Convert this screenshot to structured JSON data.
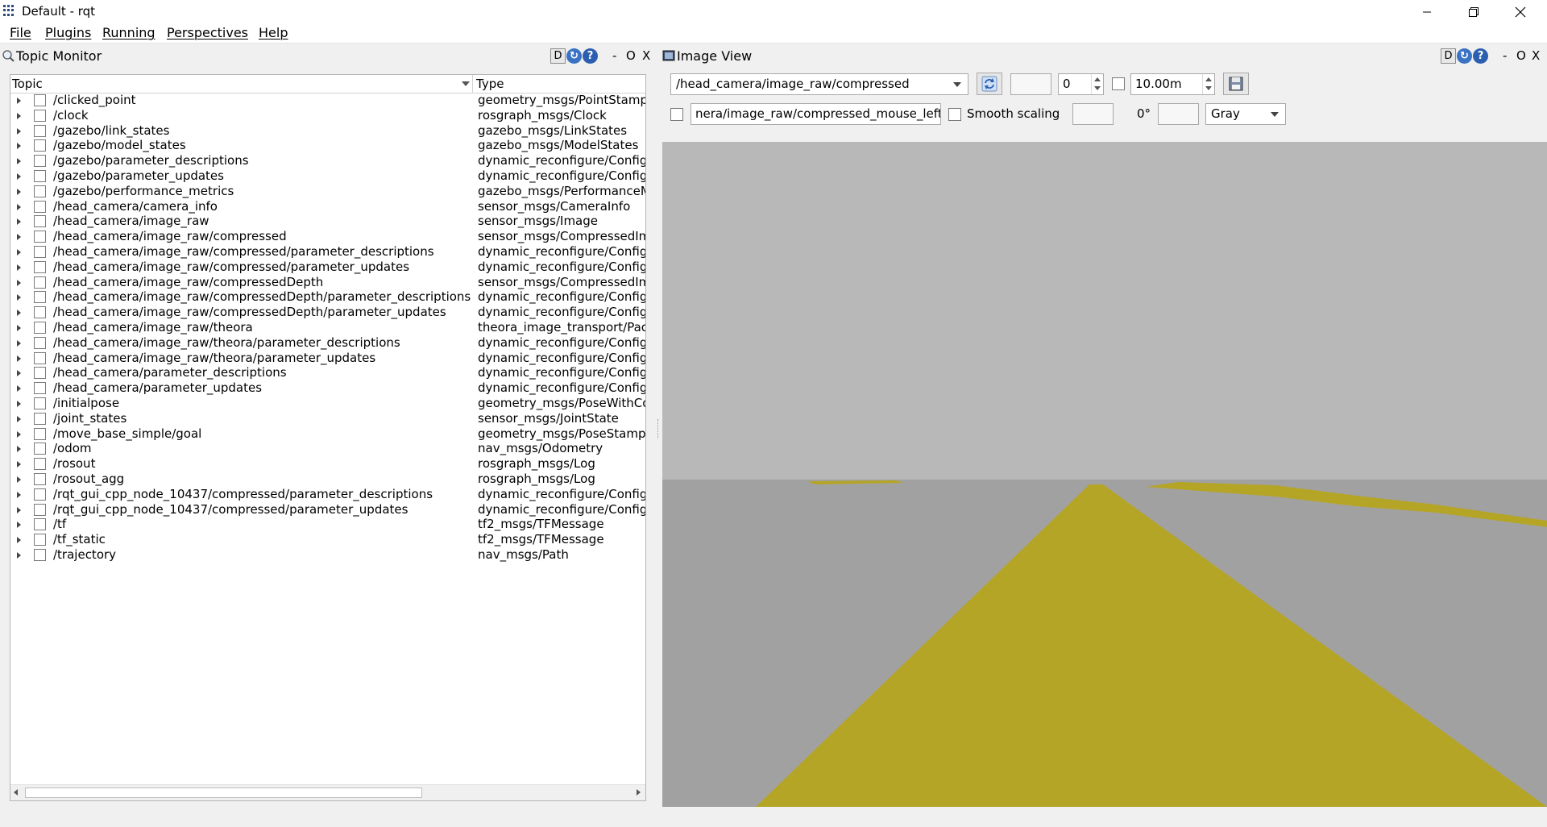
{
  "window": {
    "title": "Default - rqt",
    "minimize_icon": "minimize-icon",
    "restore_icon": "restore-icon",
    "close_icon": "close-icon"
  },
  "menu": [
    "File",
    "Plugins",
    "Running",
    "Perspectives",
    "Help"
  ],
  "topic_monitor": {
    "title": "Topic Monitor",
    "header_buttons": {
      "d": "D",
      "dash": "-",
      "o": "O",
      "x": "X"
    },
    "columns": {
      "topic": "Topic",
      "type": "Type"
    },
    "rows": [
      {
        "topic": "/clicked_point",
        "type": "geometry_msgs/PointStamped"
      },
      {
        "topic": "/clock",
        "type": "rosgraph_msgs/Clock"
      },
      {
        "topic": "/gazebo/link_states",
        "type": "gazebo_msgs/LinkStates"
      },
      {
        "topic": "/gazebo/model_states",
        "type": "gazebo_msgs/ModelStates"
      },
      {
        "topic": "/gazebo/parameter_descriptions",
        "type": "dynamic_reconfigure/ConfigDescription"
      },
      {
        "topic": "/gazebo/parameter_updates",
        "type": "dynamic_reconfigure/Config"
      },
      {
        "topic": "/gazebo/performance_metrics",
        "type": "gazebo_msgs/PerformanceMetrics"
      },
      {
        "topic": "/head_camera/camera_info",
        "type": "sensor_msgs/CameraInfo"
      },
      {
        "topic": "/head_camera/image_raw",
        "type": "sensor_msgs/Image"
      },
      {
        "topic": "/head_camera/image_raw/compressed",
        "type": "sensor_msgs/CompressedImage"
      },
      {
        "topic": "/head_camera/image_raw/compressed/parameter_descriptions",
        "type": "dynamic_reconfigure/ConfigDescription"
      },
      {
        "topic": "/head_camera/image_raw/compressed/parameter_updates",
        "type": "dynamic_reconfigure/Config"
      },
      {
        "topic": "/head_camera/image_raw/compressedDepth",
        "type": "sensor_msgs/CompressedImage"
      },
      {
        "topic": "/head_camera/image_raw/compressedDepth/parameter_descriptions",
        "type": "dynamic_reconfigure/ConfigDescription"
      },
      {
        "topic": "/head_camera/image_raw/compressedDepth/parameter_updates",
        "type": "dynamic_reconfigure/Config"
      },
      {
        "topic": "/head_camera/image_raw/theora",
        "type": "theora_image_transport/Packet"
      },
      {
        "topic": "/head_camera/image_raw/theora/parameter_descriptions",
        "type": "dynamic_reconfigure/ConfigDescription"
      },
      {
        "topic": "/head_camera/image_raw/theora/parameter_updates",
        "type": "dynamic_reconfigure/Config"
      },
      {
        "topic": "/head_camera/parameter_descriptions",
        "type": "dynamic_reconfigure/ConfigDescription"
      },
      {
        "topic": "/head_camera/parameter_updates",
        "type": "dynamic_reconfigure/Config"
      },
      {
        "topic": "/initialpose",
        "type": "geometry_msgs/PoseWithCovarianceStamped"
      },
      {
        "topic": "/joint_states",
        "type": "sensor_msgs/JointState"
      },
      {
        "topic": "/move_base_simple/goal",
        "type": "geometry_msgs/PoseStamped"
      },
      {
        "topic": "/odom",
        "type": "nav_msgs/Odometry"
      },
      {
        "topic": "/rosout",
        "type": "rosgraph_msgs/Log"
      },
      {
        "topic": "/rosout_agg",
        "type": "rosgraph_msgs/Log"
      },
      {
        "topic": "/rqt_gui_cpp_node_10437/compressed/parameter_descriptions",
        "type": "dynamic_reconfigure/ConfigDescription"
      },
      {
        "topic": "/rqt_gui_cpp_node_10437/compressed/parameter_updates",
        "type": "dynamic_reconfigure/Config"
      },
      {
        "topic": "/tf",
        "type": "tf2_msgs/TFMessage"
      },
      {
        "topic": "/tf_static",
        "type": "tf2_msgs/TFMessage"
      },
      {
        "topic": "/trajectory",
        "type": "nav_msgs/Path"
      }
    ]
  },
  "image_view": {
    "title": "Image View",
    "header_buttons": {
      "d": "D",
      "dash": "-",
      "o": "O",
      "x": "X"
    },
    "topic_select": "/head_camera/image_raw/compressed",
    "refresh_icon": "refresh-icon",
    "spin_value": "0",
    "duration_value": "10.00m",
    "save_icon": "save-icon",
    "mouse_topic": "nera/image_raw/compressed_mouse_left",
    "smooth_scaling_label": "Smooth scaling",
    "rotation_label": "0°",
    "color_scheme": "Gray",
    "colors": {
      "sky": "#b8b8b8",
      "ground": "#a1a1a1",
      "road": "#b5a526"
    }
  }
}
